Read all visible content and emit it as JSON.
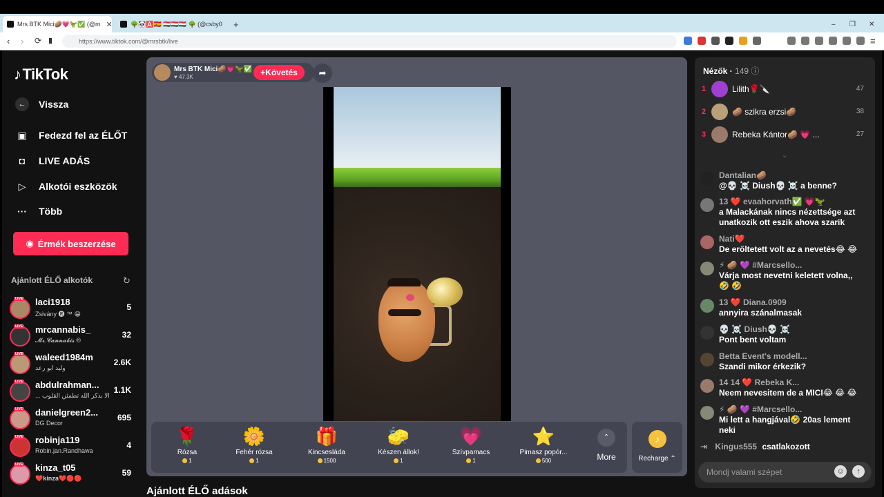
{
  "browser": {
    "tabs": [
      {
        "title": "Mrs BTK Mici🥔💗🦖✅ (@m",
        "active": true
      },
      {
        "title": "🌳🐼🅰️🇪🇸 🇭🇺🇭🇺🇭🇺 🌳 (@csby0",
        "active": false
      }
    ],
    "new_tab": "+",
    "url": "https://www.tiktok.com/@mrsbtk/live",
    "window_controls": [
      "–",
      "❐",
      "✕"
    ]
  },
  "sidebar": {
    "logo": "TikTok",
    "back_label": "Vissza",
    "nav": [
      {
        "label": "Fedezd fel az ÉLŐT",
        "icon": "explore-live-icon"
      },
      {
        "label": "LIVE ADÁS",
        "icon": "camera-icon"
      },
      {
        "label": "Alkotói eszközök",
        "icon": "creator-tools-icon"
      },
      {
        "label": "Több",
        "icon": "more-dots-icon"
      }
    ],
    "coins_button": "Érmék beszerzése",
    "suggested_title": "Ajánlott ÉLŐ alkotók",
    "creators": [
      {
        "name": "laci1918",
        "sub": "Zsivány 🅡 ™ 😁",
        "viewers": "5"
      },
      {
        "name": "mrcannabis_",
        "sub": "𝓜𝓻.𝓒𝓪𝓷𝓷𝓪𝓫𝓲𝓼 ®",
        "viewers": "32"
      },
      {
        "name": "waleed1984m",
        "sub": "وليد ابو رعد",
        "viewers": "2.6K"
      },
      {
        "name": "abdulrahman...",
        "sub": "... الا بذكر الله تطمئن القلوب",
        "viewers": "1.1K"
      },
      {
        "name": "danielgreen2...",
        "sub": "DG Decor",
        "viewers": "695"
      },
      {
        "name": "robinja119",
        "sub": "Robin.jan.Randhawa",
        "viewers": "4"
      },
      {
        "name": "kinza_t05",
        "sub": "❤️𝐤𝐢𝐧𝐳𝐚❤️🔴🔴",
        "viewers": "59"
      }
    ]
  },
  "stream": {
    "host_name": "Mrs BTK Mici🥔💗🦖✅",
    "likes": "47.3K",
    "follow_label": "Követés",
    "gifts": [
      {
        "name": "Rózsa",
        "price": "1",
        "icon": "🌹"
      },
      {
        "name": "Fehér rózsa",
        "price": "1",
        "icon": "🌼"
      },
      {
        "name": "Kincsesláda",
        "price": "1500",
        "icon": "🎁"
      },
      {
        "name": "Készen állok!",
        "price": "1",
        "icon": "🧽"
      },
      {
        "name": "Szívpamacs",
        "price": "1",
        "icon": "💗"
      },
      {
        "name": "Pimasz popór...",
        "price": "500",
        "icon": "⭐"
      }
    ],
    "more_label": "More",
    "recharge_label": "Recharge",
    "recommended_title": "Ajánlott ÉLŐ adások"
  },
  "chat": {
    "viewers_label": "Nézők",
    "viewers_count": "149",
    "top_viewers": [
      {
        "rank": "1",
        "name": "Lilith🌹🔪",
        "score": "47"
      },
      {
        "rank": "2",
        "name": "🥔 szikra erzsi🥔",
        "score": "38"
      },
      {
        "rank": "3",
        "name": "Rebeka Kántor🥔 💗 ...",
        "score": "27"
      }
    ],
    "messages": [
      {
        "name": "Dantalian🥔",
        "text": "@💀 ☠️ Diush💀 ☠️  a benne?"
      },
      {
        "name": "13 ❤️ evaahorvath✅ 💗🦖",
        "text": "a Malackának nincs nézettsége azt unatkozik ott eszik ahova szarik"
      },
      {
        "name": "Nati❤️",
        "text": "De erőltetett volt az a nevetés😂 😂"
      },
      {
        "name": "⚡ 🥔 💜 #Marcsello...",
        "text": "Várja most nevetni keletett volna,, 🤣 🤣"
      },
      {
        "name": "13 ❤️ Diana.0909",
        "text": "annyira szánalmasak"
      },
      {
        "name": "💀 ☠️ Diush💀 ☠️",
        "text": "Pont bent voltam"
      },
      {
        "name": "Betta Event's modell...",
        "text": "Szandi mikor érkezik?"
      },
      {
        "name": "14 14 ❤️ Rebeka K...",
        "text": "Neem nevesitem de a MICI😂 😂 😂"
      },
      {
        "name": "⚡ 🥔 💜 #Marcsello...",
        "text": "Mi lett a hangjával🤣 20as lement neki"
      }
    ],
    "join_user": "Kingus555",
    "join_text": "csatlakozott",
    "input_placeholder": "Mondj valami szépet"
  }
}
